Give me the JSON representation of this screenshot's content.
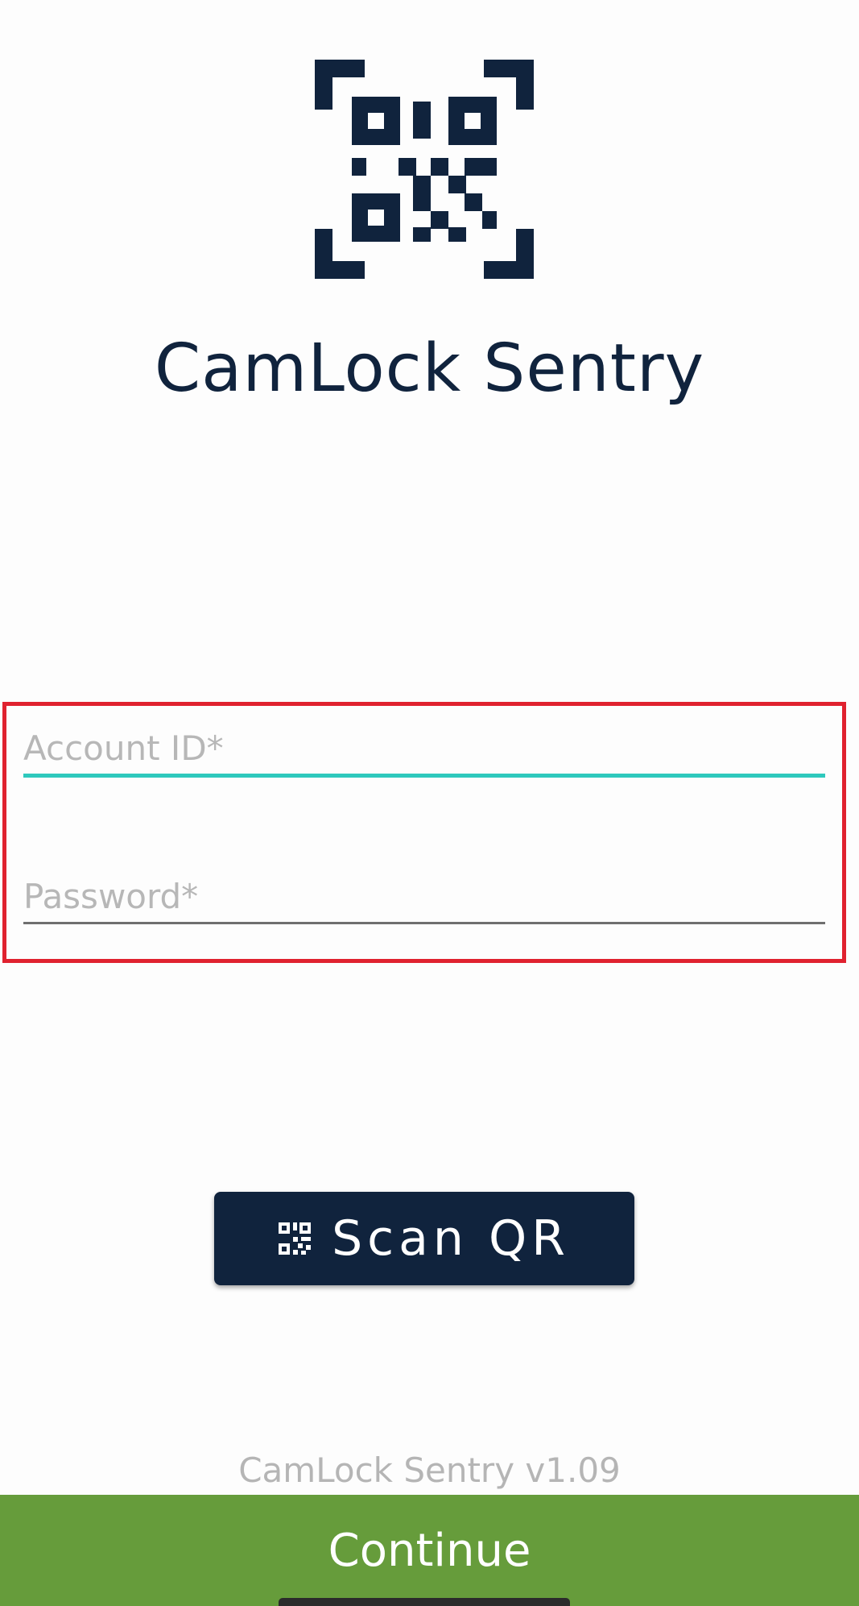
{
  "app": {
    "title": "CamLock Sentry",
    "version": "CamLock Sentry v1.09"
  },
  "form": {
    "account_id_placeholder": "Account ID*",
    "account_id_value": "",
    "password_placeholder": "Password*",
    "password_value": ""
  },
  "actions": {
    "scan_qr_label": "Scan QR",
    "continue_label": "Continue"
  },
  "icons": {
    "logo": "qr-code-scan-icon",
    "scan_button": "qr-code-icon"
  },
  "colors": {
    "brand_navy": "#10233d",
    "active_underline": "#2ec9bd",
    "highlight_border": "#e0222f",
    "continue_green": "#669c3b"
  }
}
